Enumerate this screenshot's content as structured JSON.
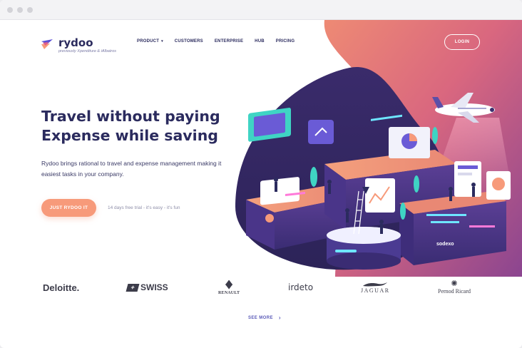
{
  "window": {
    "controls": [
      "close",
      "minimize",
      "maximize"
    ]
  },
  "brand": {
    "name": "rydoo",
    "tagline": "previously Xpenditure & iAlbatros",
    "logo_icon": "rydoo-bird-icon"
  },
  "nav": {
    "items": [
      {
        "label": "PRODUCT",
        "has_dropdown": true
      },
      {
        "label": "CUSTOMERS"
      },
      {
        "label": "ENTERPRISE"
      },
      {
        "label": "HUB"
      },
      {
        "label": "PRICING"
      }
    ],
    "login_label": "LOGIN"
  },
  "hero": {
    "headline_line1": "Travel without paying",
    "headline_line2": "Expense while saving",
    "subtext": "Rydoo brings rational to travel and expense management making it easiest tasks in your company.",
    "cta_label": "JUST RYDOO IT",
    "trial_note": "14 days free trial - it's easy - it's fun",
    "illustration_brand": "sodexo"
  },
  "clients": {
    "deloitte": "Deloitte.",
    "swiss": "SWISS",
    "renault": "RENAULT",
    "irdeto": "irdeto",
    "jaguar": "JAGUAR",
    "pernod": "Pernod Ricard"
  },
  "see_more": {
    "label": "SEE MORE",
    "icon": "chevron-right-icon"
  },
  "colors": {
    "navy": "#2b2b5e",
    "coral": "#f79a7a",
    "pink_gradient_start": "#e2707a",
    "pink_gradient_end": "#7a3f8c",
    "dark_purple": "#3b2e6e",
    "link": "#5a5ab8"
  }
}
